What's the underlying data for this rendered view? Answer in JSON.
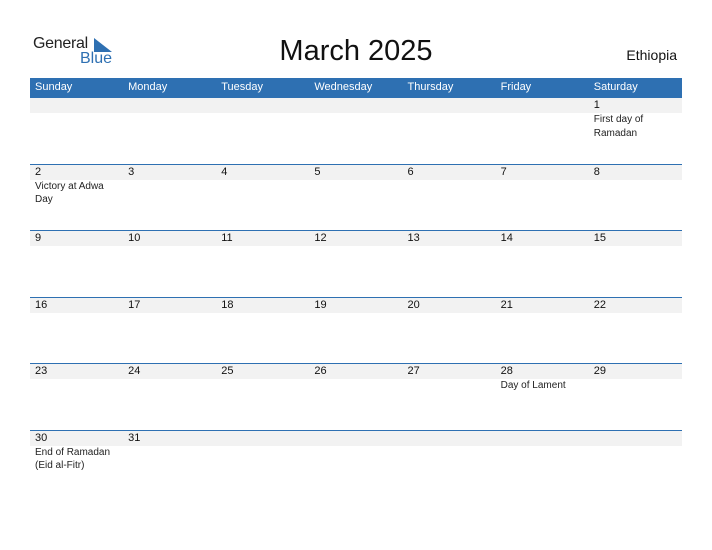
{
  "logo": {
    "general": "General",
    "blue": "Blue"
  },
  "title": "March 2025",
  "country": "Ethiopia",
  "colors": {
    "accent": "#2e70b2",
    "strip": "#f2f2f2"
  },
  "weekdays": [
    "Sunday",
    "Monday",
    "Tuesday",
    "Wednesday",
    "Thursday",
    "Friday",
    "Saturday"
  ],
  "weeks": [
    [
      {
        "day": "",
        "event": ""
      },
      {
        "day": "",
        "event": ""
      },
      {
        "day": "",
        "event": ""
      },
      {
        "day": "",
        "event": ""
      },
      {
        "day": "",
        "event": ""
      },
      {
        "day": "",
        "event": ""
      },
      {
        "day": "1",
        "event": "First day of Ramadan"
      }
    ],
    [
      {
        "day": "2",
        "event": "Victory at Adwa Day"
      },
      {
        "day": "3",
        "event": ""
      },
      {
        "day": "4",
        "event": ""
      },
      {
        "day": "5",
        "event": ""
      },
      {
        "day": "6",
        "event": ""
      },
      {
        "day": "7",
        "event": ""
      },
      {
        "day": "8",
        "event": ""
      }
    ],
    [
      {
        "day": "9",
        "event": ""
      },
      {
        "day": "10",
        "event": ""
      },
      {
        "day": "11",
        "event": ""
      },
      {
        "day": "12",
        "event": ""
      },
      {
        "day": "13",
        "event": ""
      },
      {
        "day": "14",
        "event": ""
      },
      {
        "day": "15",
        "event": ""
      }
    ],
    [
      {
        "day": "16",
        "event": ""
      },
      {
        "day": "17",
        "event": ""
      },
      {
        "day": "18",
        "event": ""
      },
      {
        "day": "19",
        "event": ""
      },
      {
        "day": "20",
        "event": ""
      },
      {
        "day": "21",
        "event": ""
      },
      {
        "day": "22",
        "event": ""
      }
    ],
    [
      {
        "day": "23",
        "event": ""
      },
      {
        "day": "24",
        "event": ""
      },
      {
        "day": "25",
        "event": ""
      },
      {
        "day": "26",
        "event": ""
      },
      {
        "day": "27",
        "event": ""
      },
      {
        "day": "28",
        "event": "Day of Lament"
      },
      {
        "day": "29",
        "event": ""
      }
    ],
    [
      {
        "day": "30",
        "event": "End of Ramadan (Eid al-Fitr)"
      },
      {
        "day": "31",
        "event": ""
      },
      {
        "day": "",
        "event": ""
      },
      {
        "day": "",
        "event": ""
      },
      {
        "day": "",
        "event": ""
      },
      {
        "day": "",
        "event": ""
      },
      {
        "day": "",
        "event": ""
      }
    ]
  ]
}
